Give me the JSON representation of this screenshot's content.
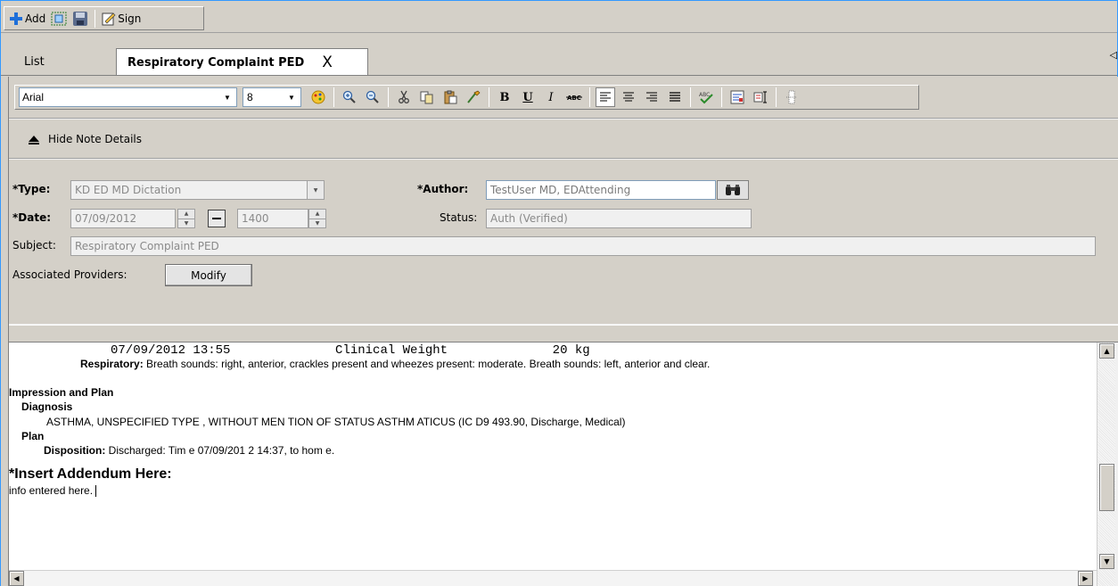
{
  "toolbar": {
    "add_label": "Add",
    "sign_label": "Sign"
  },
  "tabs": {
    "list_label": "List",
    "active_label": "Respiratory Complaint PED",
    "close_glyph": "X",
    "scroll_glyph": "◁"
  },
  "format_toolbar": {
    "font_name": "Arial",
    "font_size": "8",
    "combo_arrow": "▼",
    "bold": "B",
    "underline": "U",
    "italic": "I"
  },
  "note": {
    "hide_details_label": "Hide Note Details",
    "type_label": "*Type:",
    "type_value": "KD ED MD Dictation",
    "author_label": "*Author:",
    "author_value": "TestUser MD, EDAttending",
    "date_label": "*Date:",
    "date_value": "07/09/2012",
    "time_value": "1400",
    "status_label": "Status:",
    "status_value": "Auth (Verified)",
    "subject_label": "Subject:",
    "subject_value": "Respiratory Complaint PED",
    "providers_label": "Associated Providers:",
    "modify_label": "Modify"
  },
  "document": {
    "weight_line": "07/09/2012 13:55              Clinical Weight              20 kg",
    "respiratory_label": "Respiratory:",
    "respiratory_text": " Breath sounds: right, anterior, crackles present and wheezes present: moderate.  Breath sounds: left, anterior and clear.",
    "impression_heading": "Impression and Plan",
    "diagnosis_heading": "Diagnosis",
    "diagnosis_text": "ASTHMA, UNSPECIFIED TYPE , WITHOUT MEN TION OF STATUS ASTHM ATICUS (IC D9 493.90, Discharge, Medical)",
    "plan_heading": "Plan",
    "disposition_label": "Disposition:",
    "disposition_text": " Discharged: Tim e  07/09/201 2 14:37, to hom e.",
    "addendum_heading": "*Insert Addendum Here:",
    "addendum_text": "info entered here."
  },
  "colors": {
    "chrome": "#d4d0c8",
    "frame_border": "#3399ff",
    "add_plus": "#1e6fd9"
  }
}
